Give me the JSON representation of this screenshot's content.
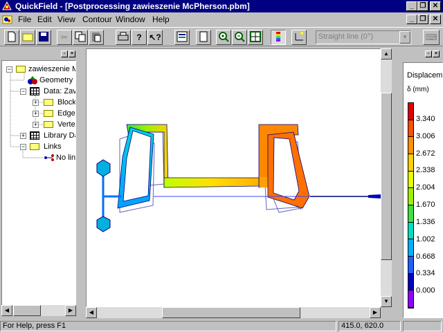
{
  "window": {
    "title": "QuickField - [Postprocessing zawieszenie McPherson.pbm]"
  },
  "menu": {
    "items": [
      "File",
      "Edit",
      "View",
      "Contour",
      "Window",
      "Help"
    ]
  },
  "toolbar": {
    "combo_value": "Straight line (0°)"
  },
  "tree": {
    "root": "zawieszenie M",
    "geometry": "Geometry",
    "data": "Data: Zav",
    "blocks": "Block",
    "edges": "Edge",
    "vertices": "Vertex",
    "library": "Library Da",
    "links": "Links",
    "nolinks": "No lin"
  },
  "legend": {
    "title": "Displacem",
    "unit": "δ (mm)",
    "values": [
      "3.340",
      "3.006",
      "2.672",
      "2.338",
      "2.004",
      "1.670",
      "1.336",
      "1.002",
      "0.668",
      "0.334",
      "0.000"
    ],
    "colors": [
      "#e00000",
      "#ff5000",
      "#ff9000",
      "#ffd000",
      "#e8ff00",
      "#a0f000",
      "#40e040",
      "#00e0c0",
      "#00b0ff",
      "#2060ff",
      "#0000c0",
      "#9000ff"
    ]
  },
  "status": {
    "help": "For Help, press F1",
    "coords": "415.0, 620.0"
  }
}
